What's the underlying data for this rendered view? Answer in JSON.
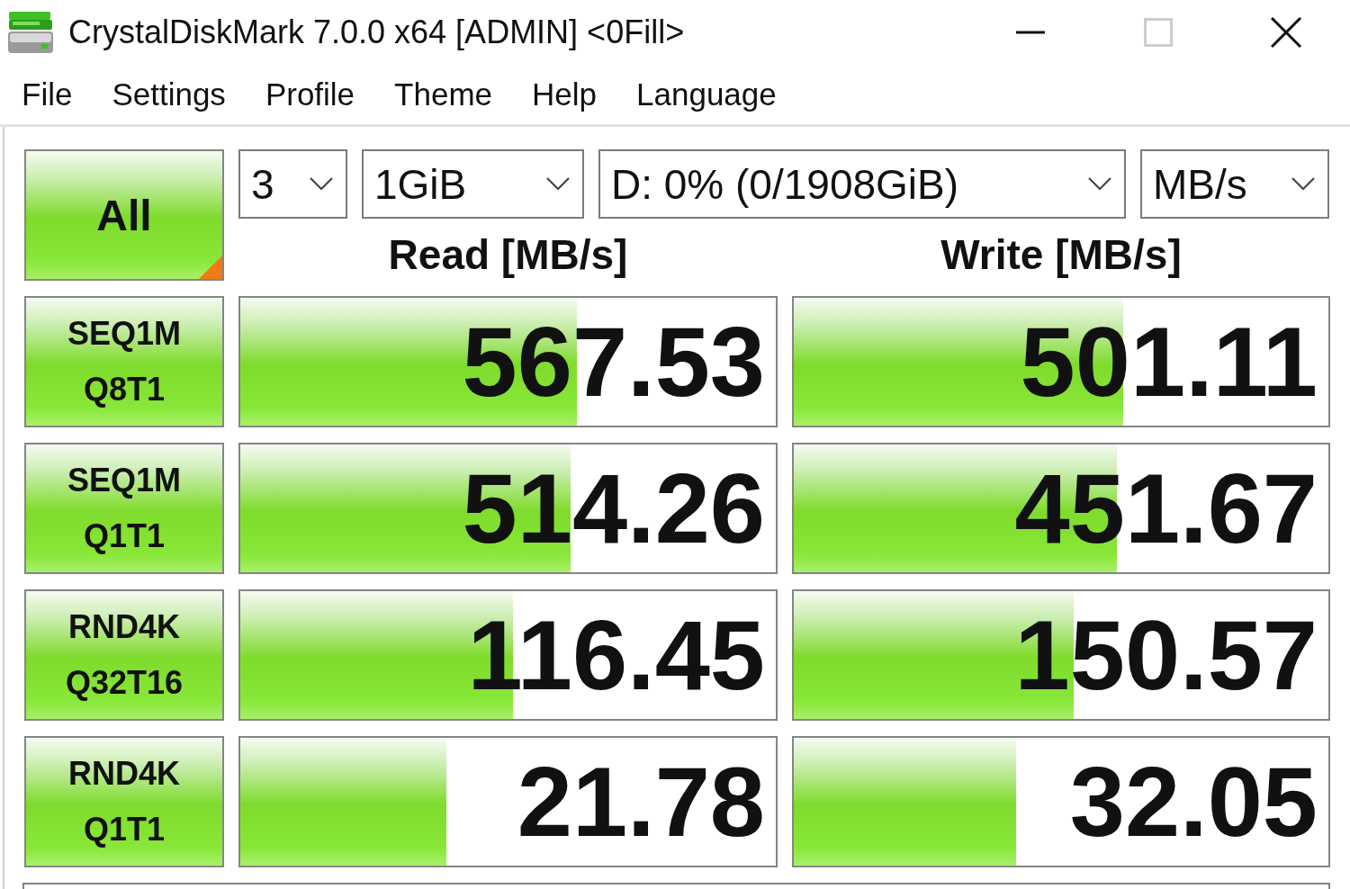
{
  "window": {
    "title": "CrystalDiskMark 7.0.0 x64 [ADMIN] <0Fill>",
    "controls": [
      {
        "kind": "minimize",
        "disabled": false
      },
      {
        "kind": "maximize",
        "disabled": true
      },
      {
        "kind": "close",
        "disabled": false
      }
    ]
  },
  "menu": [
    "File",
    "Settings",
    "Profile",
    "Theme",
    "Help",
    "Language"
  ],
  "all_button": {
    "label": "All"
  },
  "settings": [
    {
      "value": "3"
    },
    {
      "value": "1GiB"
    },
    {
      "value": "D: 0% (0/1908GiB)"
    },
    {
      "value": "MB/s"
    }
  ],
  "columns": [
    "Read [MB/s]",
    "Write [MB/s]"
  ],
  "tests": [
    {
      "label": [
        "SEQ1M",
        "Q8T1"
      ],
      "read": {
        "value": "567.53",
        "level": 0.628
      },
      "write": {
        "value": "501.11",
        "level": 0.616
      }
    },
    {
      "label": [
        "SEQ1M",
        "Q1T1"
      ],
      "read": {
        "value": "514.26",
        "level": 0.616
      },
      "write": {
        "value": "451.67",
        "level": 0.604
      }
    },
    {
      "label": [
        "RND4K",
        "Q32T16"
      ],
      "read": {
        "value": "116.45",
        "level": 0.51
      },
      "write": {
        "value": "150.57",
        "level": 0.524
      }
    },
    {
      "label": [
        "RND4K",
        "Q1T1"
      ],
      "read": {
        "value": "21.78",
        "level": 0.385
      },
      "write": {
        "value": "32.05",
        "level": 0.415
      }
    }
  ]
}
